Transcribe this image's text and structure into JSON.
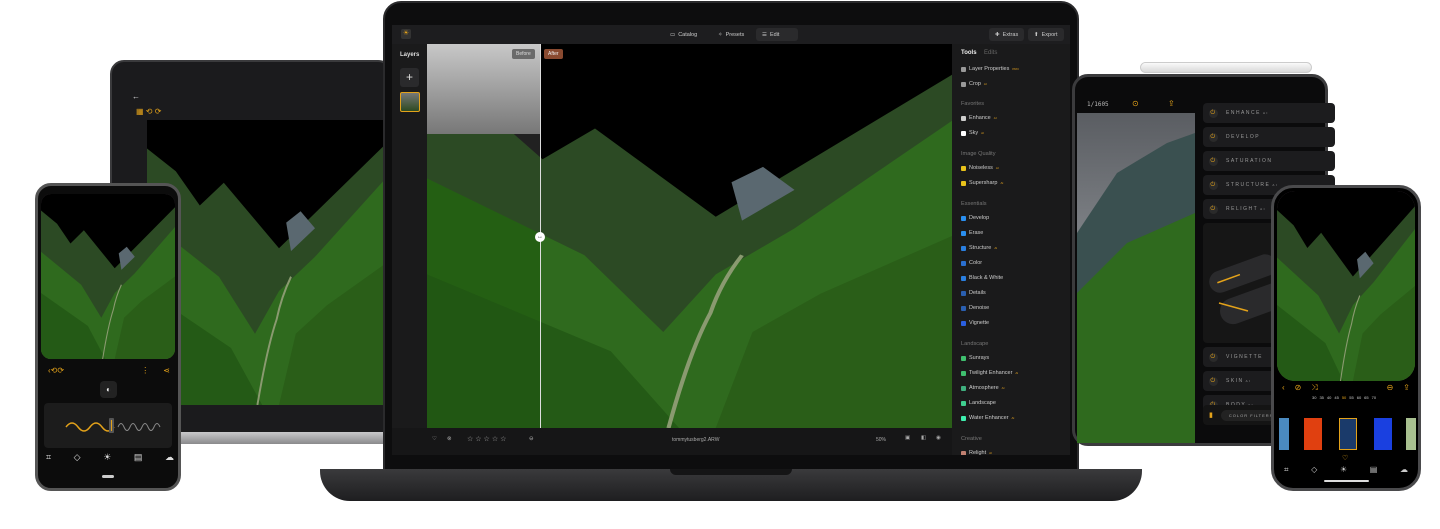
{
  "main_app": {
    "topbar": {
      "catalog": "Catalog",
      "presets": "Presets",
      "edit": "Edit",
      "extras": "Extras",
      "export": "Export"
    },
    "layers_label": "Layers",
    "compare": {
      "before": "Before",
      "after": "After"
    },
    "panel": {
      "tabs": {
        "tools": "Tools",
        "edits": "Edits"
      },
      "top_items": [
        {
          "label": "Layer Properties",
          "badge": "PRO"
        },
        {
          "label": "Crop",
          "badge": "AI"
        }
      ],
      "sections": [
        {
          "title": "Favorites",
          "items": [
            {
              "label": "Enhance",
              "badge": "AI",
              "color": "#cccccc"
            },
            {
              "label": "Sky",
              "badge": "AI",
              "color": "#ffffff"
            }
          ]
        },
        {
          "title": "Image Quality",
          "items": [
            {
              "label": "Noiseless",
              "badge": "AI",
              "color": "#e8c21a"
            },
            {
              "label": "Supersharp",
              "badge": "AI",
              "color": "#e8c21a"
            }
          ]
        },
        {
          "title": "Essentials",
          "items": [
            {
              "label": "Develop",
              "color": "#2a8ff0"
            },
            {
              "label": "Erase",
              "color": "#2a8ff0"
            },
            {
              "label": "Structure",
              "badge": "AI",
              "color": "#2a7fe0"
            },
            {
              "label": "Color",
              "color": "#2a6fd0"
            },
            {
              "label": "Black & White",
              "color": "#2a7fe0"
            },
            {
              "label": "Details",
              "color": "#2a5fb0"
            },
            {
              "label": "Denoise",
              "color": "#2a5fb0"
            },
            {
              "label": "Vignette",
              "color": "#2a5fe0"
            }
          ]
        },
        {
          "title": "Landscape",
          "items": [
            {
              "label": "Sunrays",
              "color": "#3fbf6f"
            },
            {
              "label": "Twilight Enhancer",
              "badge": "AI",
              "color": "#3fbf6f"
            },
            {
              "label": "Atmosphere",
              "badge": "AI",
              "color": "#3faf7f"
            },
            {
              "label": "Landscape",
              "color": "#3fcf8f"
            },
            {
              "label": "Water Enhancer",
              "badge": "AI",
              "color": "#3fefaf"
            }
          ]
        },
        {
          "title": "Creative",
          "items": [
            {
              "label": "Relight",
              "badge": "AI",
              "color": "#c08070"
            }
          ]
        }
      ]
    },
    "bottombar": {
      "filename": "tommytusberg2.ARW",
      "zoom": "50%",
      "rating_stars": 5
    }
  },
  "tablet": {
    "counter": "1/1605",
    "tools": [
      {
        "label": "ENHANCE",
        "badge": "AI"
      },
      {
        "label": "DEVELOP"
      },
      {
        "label": "SATURATION"
      },
      {
        "label": "STRUCTURE",
        "badge": "AI"
      },
      {
        "label": "RELIGHT",
        "badge": "AI"
      },
      {
        "label": "VIGNETTE"
      },
      {
        "label": "SKIN",
        "badge": "AI"
      },
      {
        "label": "BODY",
        "badge": "AI"
      }
    ],
    "color_filters": "COLOR FILTERS"
  },
  "iphone": {
    "dial_ticks": [
      "30",
      "35",
      "40",
      "45",
      "50",
      "55",
      "60",
      "65",
      "70"
    ],
    "selected_tick": "50"
  },
  "colors": {
    "accent": "#e3a21a",
    "panel_bg": "#1a1a1b"
  }
}
